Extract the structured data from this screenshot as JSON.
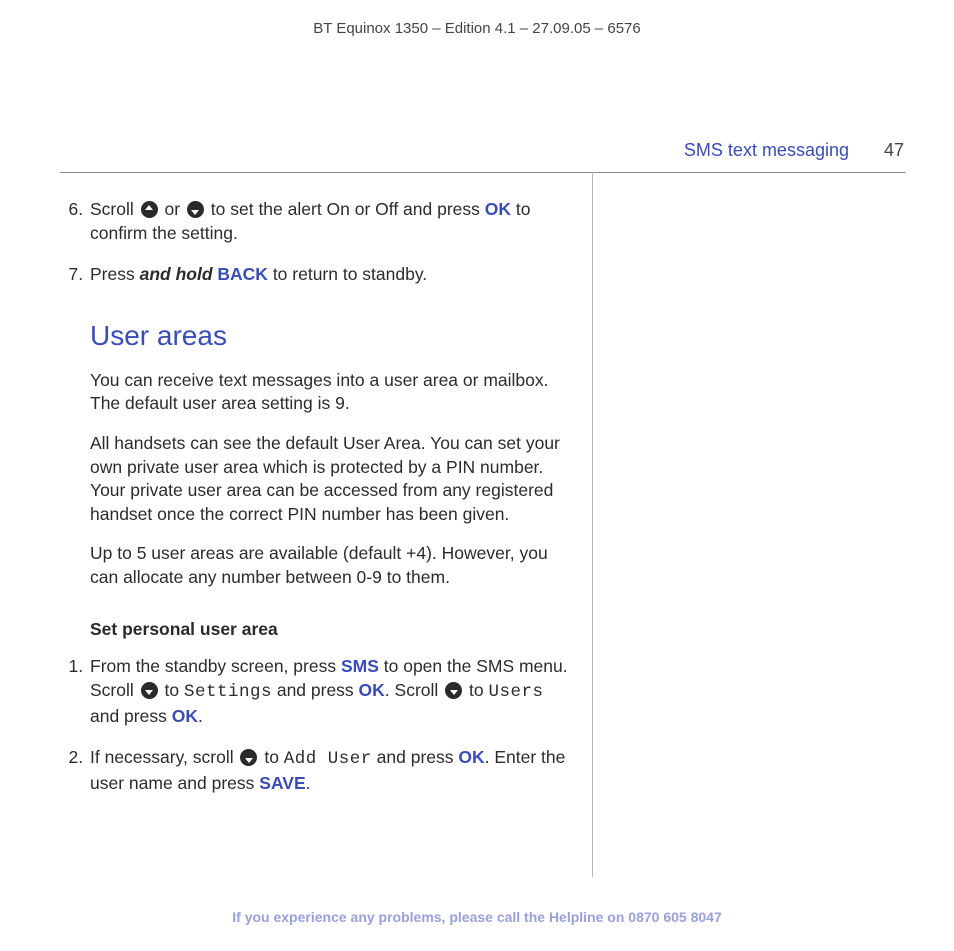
{
  "doc": {
    "header": "BT Equinox 1350 – Edition 4.1 – 27.09.05 – 6576",
    "section": "SMS text messaging",
    "page_number": "47",
    "footer_prefix": "If you experience any problems, please call the Helpline on ",
    "footer_phone": "0870 605 8047"
  },
  "keywords": {
    "ok": "OK",
    "back": "BACK",
    "sms": "SMS",
    "save": "SAVE",
    "and_hold": "and hold"
  },
  "lcd": {
    "settings": "Settings",
    "users": "Users",
    "add_user": "Add User"
  },
  "top_steps": {
    "start": 6,
    "s6_a": "Scroll ",
    "s6_b": " or ",
    "s6_c": " to set the alert On or Off and press ",
    "s6_d": " to confirm the setting.",
    "s7_a": "Press ",
    "s7_b": " to return to standby."
  },
  "user_areas": {
    "title": "User areas",
    "p1": "You can receive text messages into a user area or mailbox. The default user area setting is 9.",
    "p2": "All handsets can see the default User Area. You can set your own private user area which is protected by a PIN number. Your private user area can be accessed from any registered handset once the correct PIN number has been given.",
    "p3": "Up to 5 user areas are available (default +4). However, you can allocate any number between 0-9 to them.",
    "sub_heading": "Set personal user area"
  },
  "set_steps": {
    "s1_a": "From the standby screen, press ",
    "s1_b": " to open the SMS menu. Scroll ",
    "s1_c": " to ",
    "s1_d": " and press ",
    "s1_e": ". Scroll ",
    "s1_f": " to ",
    "s1_g": " and press ",
    "s1_h": ".",
    "s2_a": "If necessary, scroll ",
    "s2_b": " to ",
    "s2_c": " and press ",
    "s2_d": ". Enter the user name and press ",
    "s2_e": "."
  }
}
